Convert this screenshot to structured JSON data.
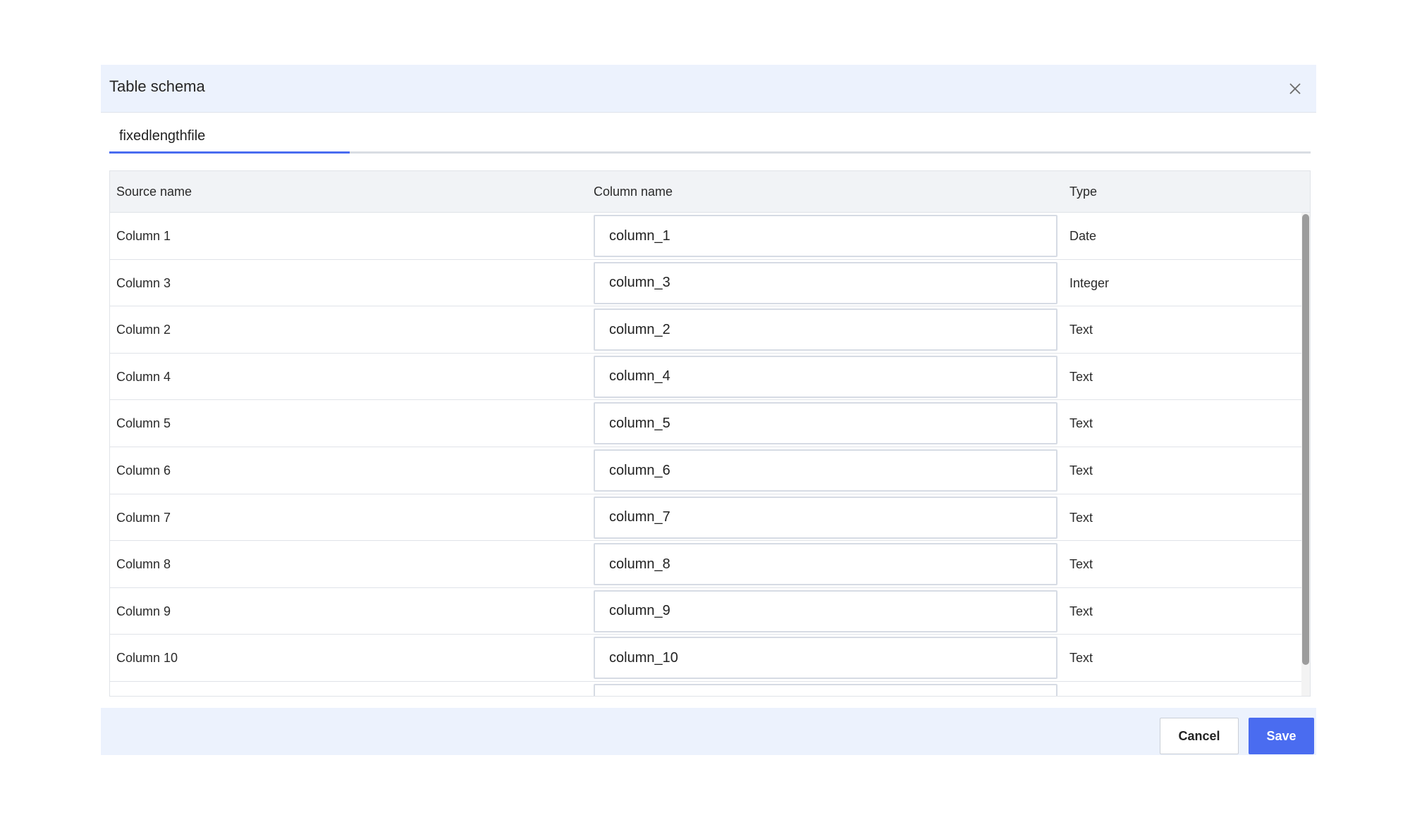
{
  "dialog": {
    "title": "Table schema",
    "close_icon": "close-icon"
  },
  "tabs": [
    {
      "label": "fixedlengthfile",
      "active": true
    }
  ],
  "table": {
    "headers": {
      "source_name": "Source name",
      "column_name": "Column name",
      "type": "Type"
    },
    "rows": [
      {
        "source": "Column 1",
        "column": "column_1",
        "type": "Date"
      },
      {
        "source": "Column 3",
        "column": "column_3",
        "type": "Integer"
      },
      {
        "source": "Column 2",
        "column": "column_2",
        "type": "Text"
      },
      {
        "source": "Column 4",
        "column": "column_4",
        "type": "Text"
      },
      {
        "source": "Column 5",
        "column": "column_5",
        "type": "Text"
      },
      {
        "source": "Column 6",
        "column": "column_6",
        "type": "Text"
      },
      {
        "source": "Column 7",
        "column": "column_7",
        "type": "Text"
      },
      {
        "source": "Column 8",
        "column": "column_8",
        "type": "Text"
      },
      {
        "source": "Column 9",
        "column": "column_9",
        "type": "Text"
      },
      {
        "source": "Column 10",
        "column": "column_10",
        "type": "Text"
      },
      {
        "source": "",
        "column": "",
        "type": ""
      }
    ]
  },
  "footer": {
    "cancel_label": "Cancel",
    "save_label": "Save"
  },
  "colors": {
    "accent": "#4a6cf0",
    "header_bg": "#ecf2fd"
  }
}
